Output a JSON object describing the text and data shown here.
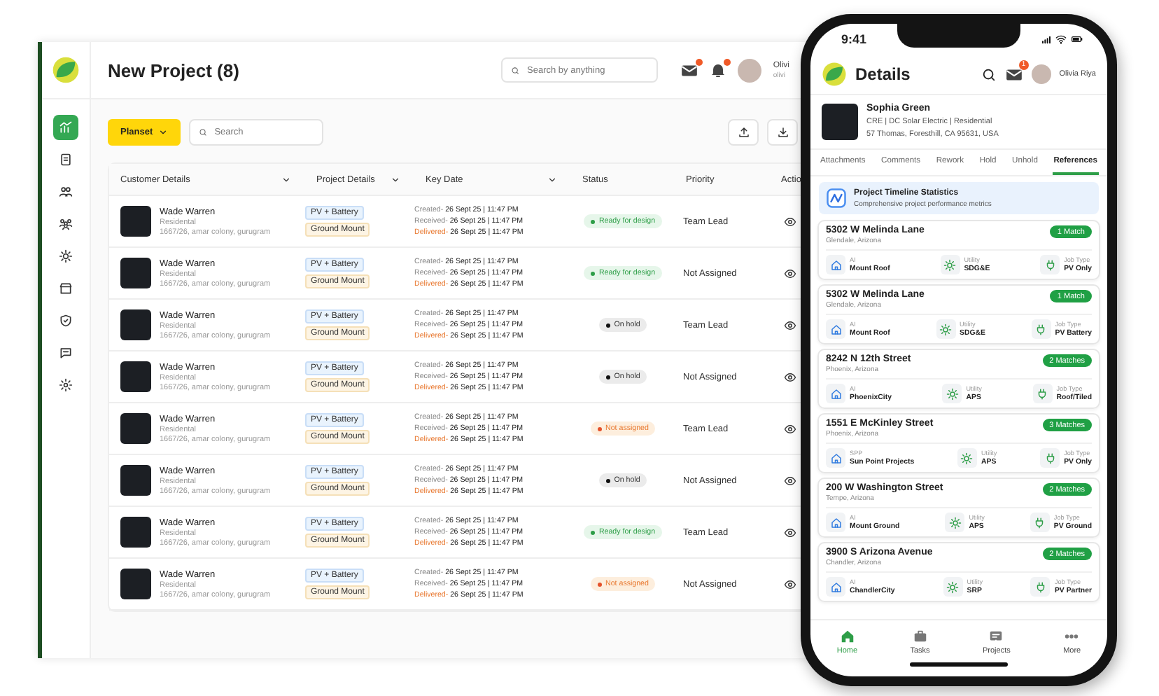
{
  "sidebar": {
    "items": [
      {
        "kind": "chart",
        "selected": true
      },
      {
        "kind": "document",
        "selected": false
      },
      {
        "kind": "users",
        "selected": false
      },
      {
        "kind": "team",
        "selected": false
      },
      {
        "kind": "sun",
        "selected": false
      },
      {
        "kind": "store",
        "selected": false
      },
      {
        "kind": "shield",
        "selected": false
      },
      {
        "kind": "chat",
        "selected": false
      },
      {
        "kind": "gear",
        "selected": false
      }
    ]
  },
  "header": {
    "title": "New Project (8)",
    "search": {
      "placeholder": "Search by anything"
    },
    "user": {
      "name": "Olivi",
      "email": "olivi"
    }
  },
  "toolbar": {
    "planset": "Planset",
    "search": {
      "placeholder": "Search"
    }
  },
  "table": {
    "columns": [
      {
        "label": "Customer Details",
        "sortable": true
      },
      {
        "label": "Project Details",
        "sortable": true
      },
      {
        "label": "Key Date",
        "sortable": true
      },
      {
        "label": "Status",
        "sortable": false
      },
      {
        "label": "Priority",
        "sortable": false
      },
      {
        "label": "Actio",
        "sortable": false
      }
    ],
    "rows": [
      {
        "name": "Wade Warren",
        "type": "Residental",
        "address": "1667/26, amar colony, gurugram",
        "tags": [
          "PV + Battery",
          "Ground Mount"
        ],
        "dates": [
          {
            "label": "Created-",
            "value": " 26 Sept 25 | 11:47 PM",
            "kind": "plain"
          },
          {
            "label": "Received-",
            "value": " 26 Sept 25 | 11:47 PM",
            "kind": "plain"
          },
          {
            "label": "Delivered-",
            "value": " 26 Sept 25 | 11:47 PM",
            "kind": "delivered"
          }
        ],
        "status": {
          "text": "Ready for design",
          "kind": "ready"
        },
        "priority": "Team Lead"
      },
      {
        "name": "Wade Warren",
        "type": "Residental",
        "address": "1667/26, amar colony, gurugram",
        "tags": [
          "PV + Battery",
          "Ground Mount"
        ],
        "dates": [
          {
            "label": "Created-",
            "value": " 26 Sept 25 | 11:47 PM",
            "kind": "plain"
          },
          {
            "label": "Received-",
            "value": " 26 Sept 25 | 11:47 PM",
            "kind": "plain"
          },
          {
            "label": "Delivered-",
            "value": " 26 Sept 25 | 11:47 PM",
            "kind": "delivered"
          }
        ],
        "status": {
          "text": "Ready for design",
          "kind": "ready"
        },
        "priority": "Not Assigned"
      },
      {
        "name": "Wade Warren",
        "type": "Residental",
        "address": "1667/26, amar colony, gurugram",
        "tags": [
          "PV + Battery",
          "Ground Mount"
        ],
        "dates": [
          {
            "label": "Created-",
            "value": " 26 Sept 25 | 11:47 PM",
            "kind": "plain"
          },
          {
            "label": "Received-",
            "value": " 26 Sept 25 | 11:47 PM",
            "kind": "plain"
          },
          {
            "label": "Delivered-",
            "value": " 26 Sept 25 | 11:47 PM",
            "kind": "delivered"
          }
        ],
        "status": {
          "text": "On hold",
          "kind": "hold"
        },
        "priority": "Team Lead"
      },
      {
        "name": "Wade Warren",
        "type": "Residental",
        "address": "1667/26, amar colony, gurugram",
        "tags": [
          "PV + Battery",
          "Ground Mount"
        ],
        "dates": [
          {
            "label": "Created-",
            "value": " 26 Sept 25 | 11:47 PM",
            "kind": "plain"
          },
          {
            "label": "Received-",
            "value": " 26 Sept 25 | 11:47 PM",
            "kind": "plain"
          },
          {
            "label": "Delivered-",
            "value": " 26 Sept 25 | 11:47 PM",
            "kind": "delivered"
          }
        ],
        "status": {
          "text": "On hold",
          "kind": "hold"
        },
        "priority": "Not Assigned"
      },
      {
        "name": "Wade Warren",
        "type": "Residental",
        "address": "1667/26, amar colony, gurugram",
        "tags": [
          "PV + Battery",
          "Ground Mount"
        ],
        "dates": [
          {
            "label": "Created-",
            "value": " 26 Sept 25 | 11:47 PM",
            "kind": "plain"
          },
          {
            "label": "Received-",
            "value": " 26 Sept 25 | 11:47 PM",
            "kind": "plain"
          },
          {
            "label": "Delivered-",
            "value": " 26 Sept 25 | 11:47 PM",
            "kind": "delivered"
          }
        ],
        "status": {
          "text": "Not assigned",
          "kind": "unassigned"
        },
        "priority": "Team Lead"
      },
      {
        "name": "Wade Warren",
        "type": "Residental",
        "address": "1667/26, amar colony, gurugram",
        "tags": [
          "PV + Battery",
          "Ground Mount"
        ],
        "dates": [
          {
            "label": "Created-",
            "value": " 26 Sept 25 | 11:47 PM",
            "kind": "plain"
          },
          {
            "label": "Received-",
            "value": " 26 Sept 25 | 11:47 PM",
            "kind": "plain"
          },
          {
            "label": "Delivered-",
            "value": " 26 Sept 25 | 11:47 PM",
            "kind": "delivered"
          }
        ],
        "status": {
          "text": "On hold",
          "kind": "hold"
        },
        "priority": "Not Assigned"
      },
      {
        "name": "Wade Warren",
        "type": "Residental",
        "address": "1667/26, amar colony, gurugram",
        "tags": [
          "PV + Battery",
          "Ground Mount"
        ],
        "dates": [
          {
            "label": "Created-",
            "value": " 26 Sept 25 | 11:47 PM",
            "kind": "plain"
          },
          {
            "label": "Received-",
            "value": " 26 Sept 25 | 11:47 PM",
            "kind": "plain"
          },
          {
            "label": "Delivered-",
            "value": " 26 Sept 25 | 11:47 PM",
            "kind": "delivered"
          }
        ],
        "status": {
          "text": "Ready for design",
          "kind": "ready"
        },
        "priority": "Team Lead"
      },
      {
        "name": "Wade Warren",
        "type": "Residental",
        "address": "1667/26, amar colony, gurugram",
        "tags": [
          "PV + Battery",
          "Ground Mount"
        ],
        "dates": [
          {
            "label": "Created-",
            "value": " 26 Sept 25 | 11:47 PM",
            "kind": "plain"
          },
          {
            "label": "Received-",
            "value": " 26 Sept 25 | 11:47 PM",
            "kind": "plain"
          },
          {
            "label": "Delivered-",
            "value": " 26 Sept 25 | 11:47 PM",
            "kind": "delivered"
          }
        ],
        "status": {
          "text": "Not assigned",
          "kind": "unassigned"
        },
        "priority": "Not Assigned"
      }
    ]
  },
  "phone": {
    "time": "9:41",
    "title": "Details",
    "mail_badge": "1",
    "user": "Olivia Riya",
    "profile": {
      "name": "Sophia Green",
      "company": "CRE | DC Solar Electric | Residential",
      "address": "57 Thomas, Foresthill, CA 95631, USA"
    },
    "tabs": [
      {
        "label": "Attachments",
        "selected": false
      },
      {
        "label": "Comments",
        "selected": false
      },
      {
        "label": "Rework",
        "selected": false
      },
      {
        "label": "Hold",
        "selected": false
      },
      {
        "label": "Unhold",
        "selected": false
      },
      {
        "label": "References",
        "selected": true
      }
    ],
    "stats": {
      "title": "Project Timeline Statistics",
      "subtitle": "Comprehensive project performance metrics"
    },
    "references": [
      {
        "street": "5302 W Melinda Lane",
        "city": "Glendale, Arizona",
        "matches": "1 Match",
        "fields": [
          {
            "kind": "home",
            "label": "AI",
            "value": "Mount Roof"
          },
          {
            "kind": "sun",
            "label": "Utility",
            "value": "SDG&E"
          },
          {
            "kind": "job",
            "label": "Job Type",
            "value": "PV Only"
          }
        ]
      },
      {
        "street": "5302 W Melinda Lane",
        "city": "Glendale, Arizona",
        "matches": "1 Match",
        "fields": [
          {
            "kind": "home",
            "label": "AI",
            "value": "Mount Roof"
          },
          {
            "kind": "sun",
            "label": "Utility",
            "value": "SDG&E"
          },
          {
            "kind": "job",
            "label": "Job Type",
            "value": "PV Battery"
          }
        ]
      },
      {
        "street": "8242 N 12th Street",
        "city": "Phoenix, Arizona",
        "matches": "2 Matches",
        "fields": [
          {
            "kind": "home",
            "label": "AI",
            "value": "PhoenixCity"
          },
          {
            "kind": "sun",
            "label": "Utility",
            "value": "APS"
          },
          {
            "kind": "job",
            "label": "Job Type",
            "value": "Roof/Tiled"
          }
        ]
      },
      {
        "street": "1551 E McKinley Street",
        "city": "Phoenix, Arizona",
        "matches": "3 Matches",
        "fields": [
          {
            "kind": "home",
            "label": "SPP",
            "value": "Sun Point Projects"
          },
          {
            "kind": "sun",
            "label": "Utility",
            "value": "APS"
          },
          {
            "kind": "job",
            "label": "Job Type",
            "value": "PV Only"
          }
        ]
      },
      {
        "street": "200 W Washington Street",
        "city": "Tempe, Arizona",
        "matches": "2 Matches",
        "fields": [
          {
            "kind": "home",
            "label": "AI",
            "value": "Mount Ground"
          },
          {
            "kind": "sun",
            "label": "Utility",
            "value": "APS"
          },
          {
            "kind": "job",
            "label": "Job Type",
            "value": "PV Ground"
          }
        ]
      },
      {
        "street": "3900 S Arizona Avenue",
        "city": "Chandler, Arizona",
        "matches": "2 Matches",
        "fields": [
          {
            "kind": "home",
            "label": "AI",
            "value": "ChandlerCity"
          },
          {
            "kind": "sun",
            "label": "Utility",
            "value": "SRP"
          },
          {
            "kind": "job",
            "label": "Job Type",
            "value": "PV Partner"
          }
        ]
      }
    ],
    "nav": [
      {
        "kind": "home",
        "label": "Home",
        "selected": true
      },
      {
        "kind": "tasks",
        "label": "Tasks",
        "selected": false
      },
      {
        "kind": "projects",
        "label": "Projects",
        "selected": false
      },
      {
        "kind": "more",
        "label": "More",
        "selected": false
      }
    ]
  }
}
